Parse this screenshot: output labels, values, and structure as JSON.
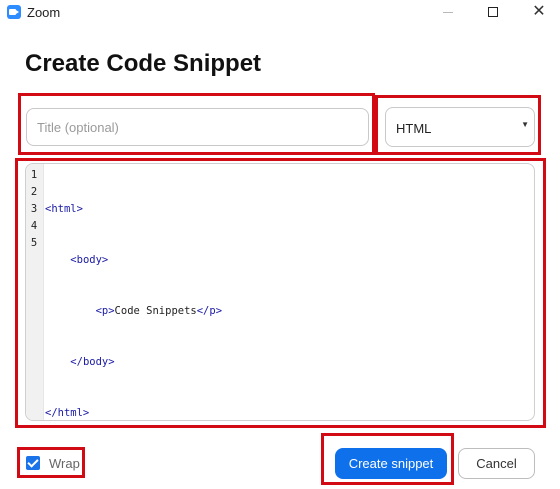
{
  "window": {
    "app_title": "Zoom",
    "close_glyph": "✕"
  },
  "dialog": {
    "heading": "Create Code Snippet",
    "title_field": {
      "placeholder": "Title (optional)",
      "value": ""
    },
    "language": {
      "selected": "HTML",
      "caret": "▼"
    },
    "editor": {
      "lines": [
        {
          "num": "1",
          "indent": "",
          "tag_open": "<html>",
          "text": "",
          "tag_close": ""
        },
        {
          "num": "2",
          "indent": "    ",
          "tag_open": "<body>",
          "text": "",
          "tag_close": ""
        },
        {
          "num": "3",
          "indent": "        ",
          "tag_open": "<p>",
          "text": "Code Snippets",
          "tag_close": "</p>"
        },
        {
          "num": "4",
          "indent": "    ",
          "tag_open": "</body>",
          "text": "",
          "tag_close": ""
        },
        {
          "num": "5",
          "indent": "",
          "tag_open": "</html>",
          "text": "",
          "tag_close": ""
        }
      ]
    },
    "wrap": {
      "label": "Wrap",
      "checked": true
    },
    "create_button": "Create snippet",
    "cancel_button": "Cancel"
  },
  "colors": {
    "accent": "#0e71eb",
    "highlight_frame": "#d20a14",
    "code_tag": "#1a1aa6"
  }
}
